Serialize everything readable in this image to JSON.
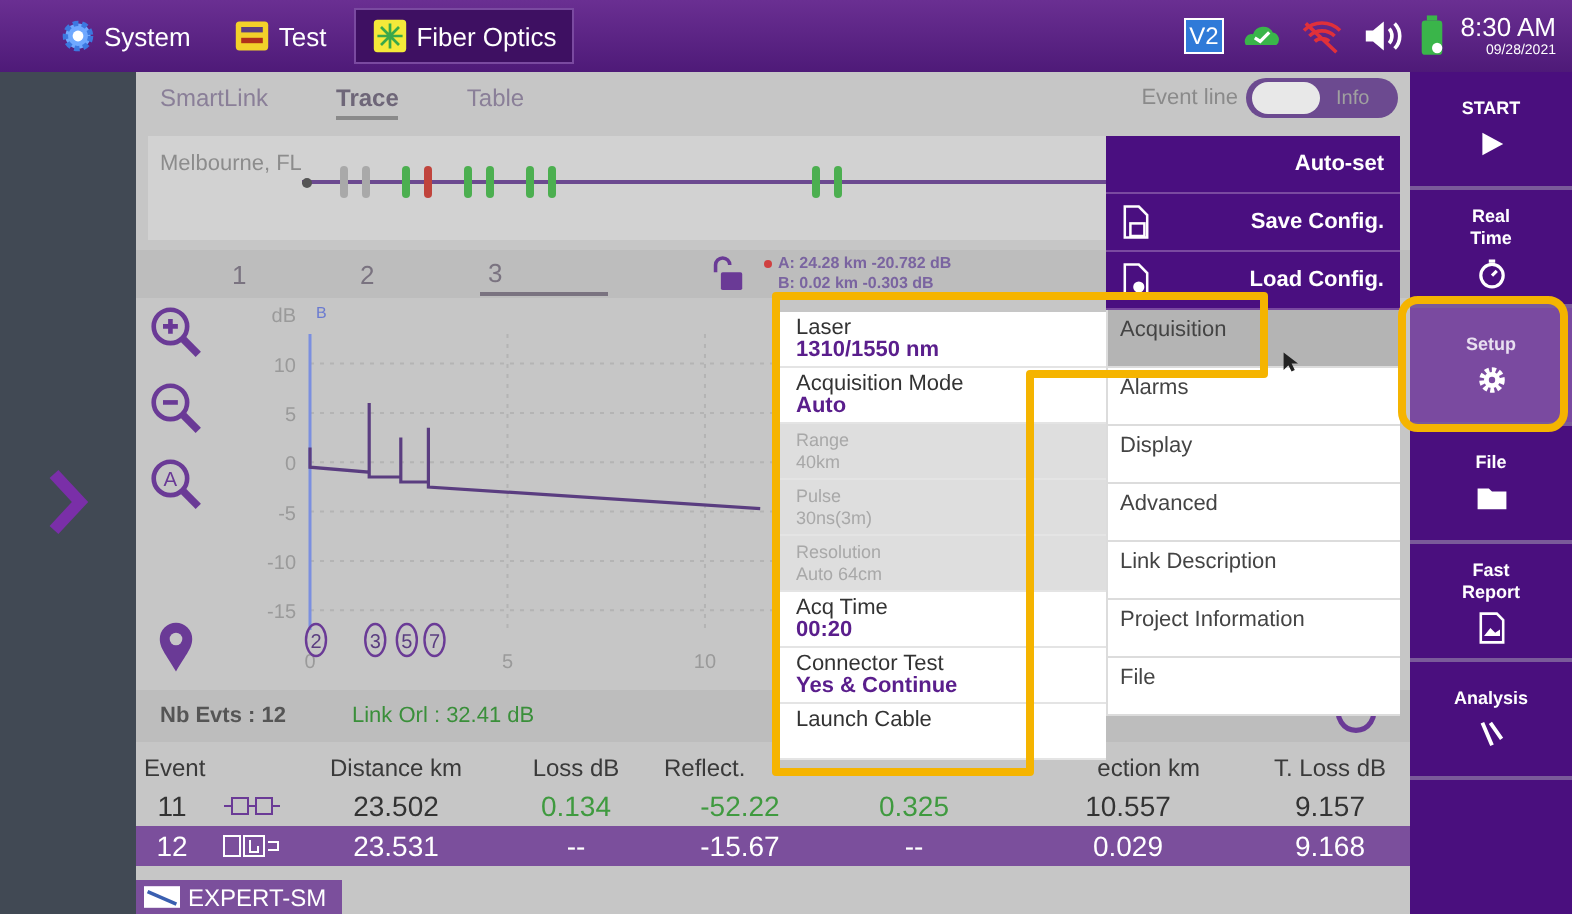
{
  "top_bar": {
    "tabs": [
      {
        "label": "System",
        "selected": false
      },
      {
        "label": "Test",
        "selected": false
      },
      {
        "label": "Fiber Optics",
        "selected": true
      }
    ],
    "status_badge": "V2",
    "time": "8:30 AM",
    "date": "09/28/2021"
  },
  "view_tabs": [
    {
      "label": "SmartLink",
      "selected": false
    },
    {
      "label": "Trace",
      "selected": true
    },
    {
      "label": "Table",
      "selected": false
    }
  ],
  "event_line": {
    "label": "Event line",
    "on": false,
    "option": "Info"
  },
  "link_map": {
    "location": "Melbourne, FL",
    "groups": [
      [
        [
          {
            "color": "#a9a9a9"
          },
          {
            "color": "#a9a9a9"
          }
        ],
        [
          {
            "color": "#4caf50"
          },
          {
            "color": "#c0443c"
          }
        ],
        [
          {
            "color": "#4caf50"
          },
          {
            "color": "#4caf50"
          }
        ],
        [
          {
            "color": "#4caf50"
          },
          {
            "color": "#4caf50"
          }
        ]
      ],
      [
        [
          {
            "color": "#4caf50"
          },
          {
            "color": "#4caf50"
          }
        ]
      ]
    ]
  },
  "trace_tabs": [
    {
      "label": "1",
      "selected": false
    },
    {
      "label": "2",
      "selected": false
    },
    {
      "label": "3",
      "selected": true
    }
  ],
  "cursors": {
    "locked": false,
    "a": "A: 24.28 km -20.782 dB",
    "b": "B: 0.02 km -0.303 dB"
  },
  "chart": {
    "zoom_auto": "A",
    "cursor_label": "B",
    "event_markers": [
      "2",
      "3",
      "5",
      "7"
    ],
    "chart_data": {
      "type": "line",
      "ylabel": "dB",
      "x": [
        0,
        0,
        1.5,
        1.5,
        1.5,
        2.3,
        2.3,
        2.3,
        3,
        3,
        3,
        11.4
      ],
      "grid": true,
      "series": [
        {
          "color": "#5a3d80",
          "values": [
            1.5,
            -0.5,
            -1,
            6,
            -1.5,
            -1.5,
            2.5,
            -2,
            -2,
            3.5,
            -2.5,
            -4.7
          ]
        }
      ],
      "xlim": [
        0,
        11.9
      ],
      "ylim": [
        -17,
        13
      ],
      "xticks": [
        0,
        5,
        10
      ],
      "yticks": [
        10,
        5,
        0,
        -5,
        -10,
        -15
      ]
    }
  },
  "summary": {
    "events": "Nb Evts : 12",
    "orl": "Link Orl :  32.41 dB"
  },
  "table": {
    "columns": [
      "Event",
      "Distance  km",
      "Loss dB",
      "Reflect.",
      "ection km",
      "T. Loss dB"
    ],
    "rows": [
      {
        "selected": false,
        "pass": true,
        "kind": "connector",
        "event": "11",
        "distance": "23.502",
        "loss": "0.134",
        "reflectance": "-52.22",
        "column_6": "0.325",
        "section": "10.557",
        "total_loss": "9.157"
      },
      {
        "selected": true,
        "pass": false,
        "kind": "end",
        "event": "12",
        "distance": "23.531",
        "loss": "--",
        "reflectance": "-15.67",
        "column_6": "--",
        "section": "0.029",
        "total_loss": "9.168"
      }
    ]
  },
  "bottom_tab": {
    "label": "EXPERT-SM"
  },
  "setup_menu": {
    "actions": [
      {
        "label": "Auto-set"
      },
      {
        "label": "Save Config."
      },
      {
        "label": "Load Config."
      }
    ],
    "sections": [
      {
        "label": "Acquisition",
        "selected": true
      },
      {
        "label": "Alarms",
        "selected": false
      },
      {
        "label": "Display",
        "selected": false
      },
      {
        "label": "Advanced",
        "selected": false
      },
      {
        "label": "Link Description",
        "selected": false
      },
      {
        "label": "Project Information",
        "selected": false
      },
      {
        "label": "File",
        "selected": false
      }
    ]
  },
  "acquisition_params": [
    {
      "label": "Laser",
      "value": "1310/1550 nm",
      "disabled": false
    },
    {
      "label": "Acquisition Mode",
      "value": "Auto",
      "disabled": false
    },
    {
      "label": "Range",
      "value": "40km",
      "disabled": true
    },
    {
      "label": "Pulse",
      "value": "30ns(3m)",
      "disabled": true
    },
    {
      "label": "Resolution",
      "value": "Auto 64cm",
      "disabled": true
    },
    {
      "label": "Acq Time",
      "value": "00:20",
      "disabled": false
    },
    {
      "label": "Connector Test",
      "value": "Yes & Continue",
      "disabled": false
    },
    {
      "label": "Launch Cable",
      "disabled": false
    }
  ],
  "sidebar": [
    {
      "label": "START",
      "selected": false
    },
    {
      "label": "Real Time",
      "selected": false
    },
    {
      "label": "Setup",
      "selected": true
    },
    {
      "label": "File",
      "selected": false
    },
    {
      "label": "Fast Report",
      "selected": false
    },
    {
      "label": "Analysis",
      "selected": false
    }
  ]
}
